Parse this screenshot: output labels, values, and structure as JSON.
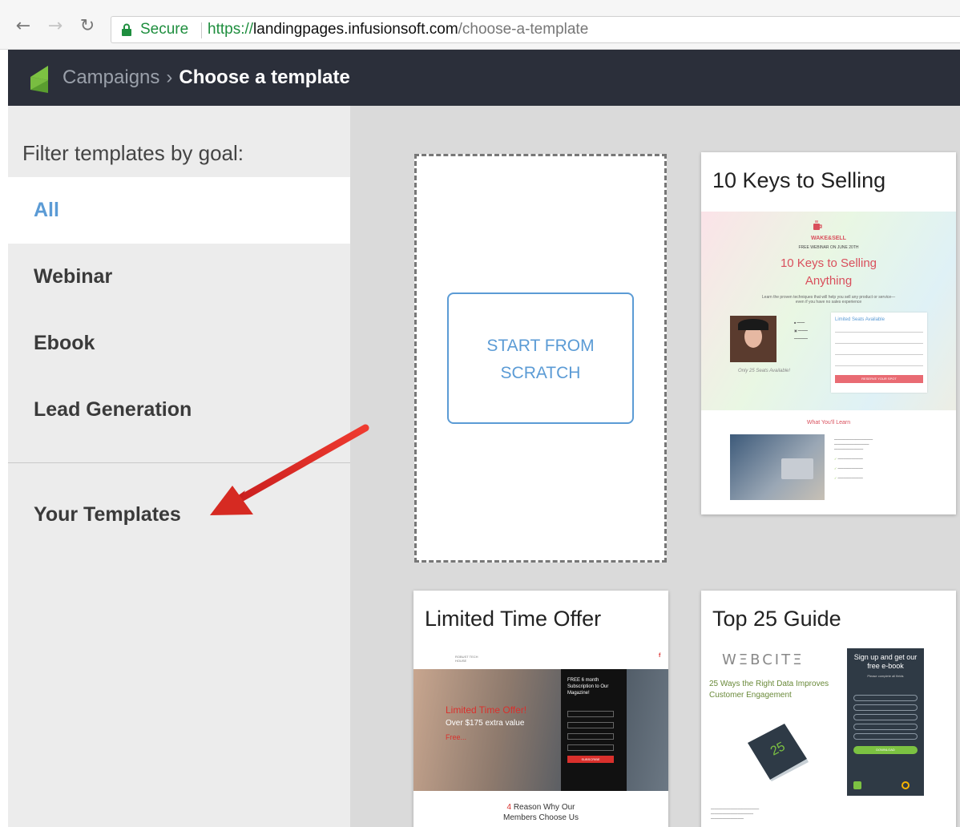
{
  "browser": {
    "secure_label": "Secure",
    "url_scheme": "https://",
    "url_host": "landingpages.infusionsoft.com",
    "url_path": "/choose-a-template"
  },
  "header": {
    "breadcrumb_parent": "Campaigns",
    "breadcrumb_separator": "›",
    "breadcrumb_current": "Choose a template",
    "accent_color": "#2b2f3a"
  },
  "sidebar": {
    "title": "Filter templates by goal:",
    "items": [
      {
        "label": "All",
        "active": true
      },
      {
        "label": "Webinar",
        "active": false
      },
      {
        "label": "Ebook",
        "active": false
      },
      {
        "label": "Lead Generation",
        "active": false
      }
    ],
    "your_templates": "Your Templates"
  },
  "main": {
    "scratch_label_line1": "START FROM",
    "scratch_label_line2": "SCRATCH",
    "templates": [
      {
        "title": "10 Keys to Selling",
        "preview": {
          "brand": "WAKE&SELL",
          "subhead": "FREE WEBINAR ON JUNE 20TH",
          "headline1": "10 Keys to Selling",
          "headline2": "Anything",
          "intro": "Learn the proven techniques that will help you sell any product or service—even if you have no sales experience",
          "form_title": "Limited Seats Available",
          "seats_note": "Only 25 Seats Available!",
          "cta": "RESERVE YOUR SPOT",
          "section_title": "What You'll Learn"
        }
      },
      {
        "title": "Limited Time Offer",
        "preview": {
          "logo": "ROBUST TECH HOUSE",
          "headline": "Limited Time Offer!",
          "value": "Over $175 extra value",
          "free": "Free...",
          "box_title": "FREE 6 month Subscription to Our Magazine!",
          "cta": "SUBSCRIBE",
          "footer_num": "4",
          "footer_line1": "Reason Why Our",
          "footer_line2": "Members Choose Us"
        }
      },
      {
        "title": "Top 25 Guide",
        "preview": {
          "brand": "WΞBCITΞ",
          "headline": "25 Ways the Right Data Improves Customer Engagement",
          "box_title": "Sign up and get our free e-book",
          "box_sub": "Please complete all fields",
          "cta": "DOWNLOAD"
        }
      }
    ]
  }
}
